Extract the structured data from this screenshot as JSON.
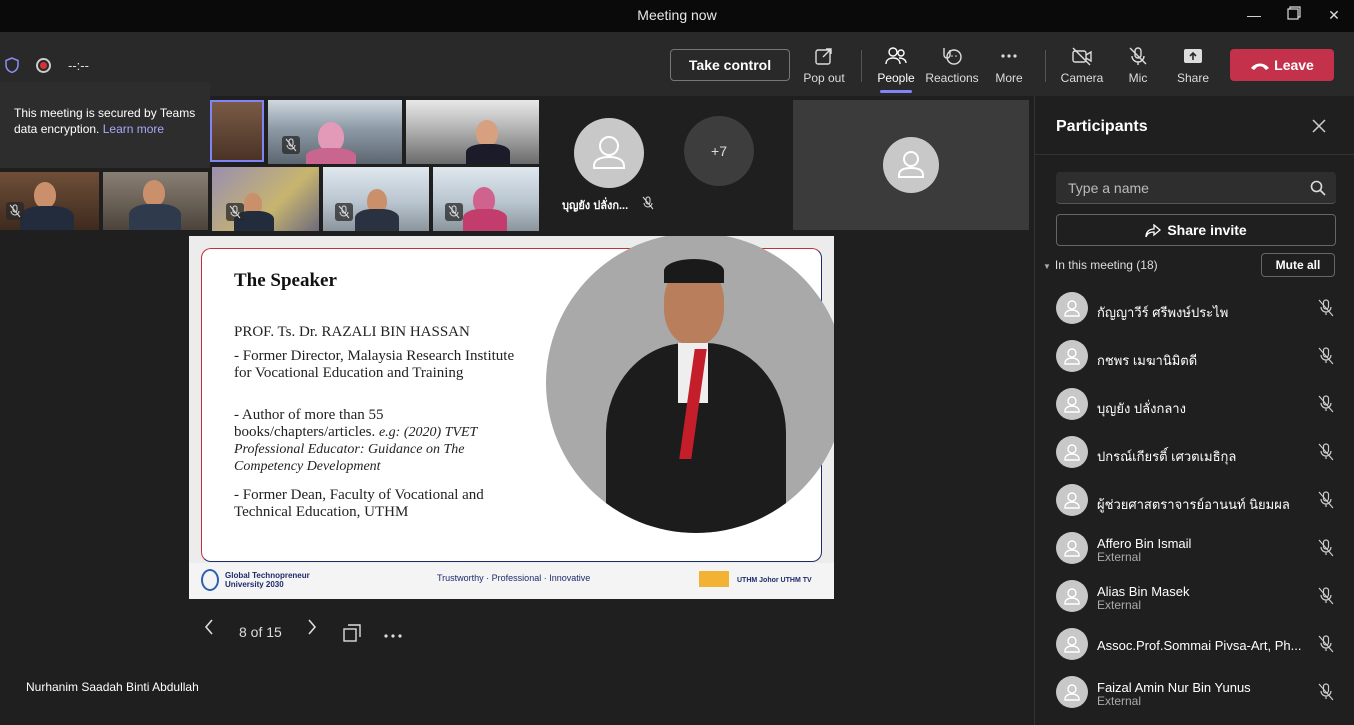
{
  "window": {
    "title": "Meeting now"
  },
  "toolbar": {
    "timer": "--:--",
    "take_control": "Take control",
    "pop_out": "Pop out",
    "people": "People",
    "reactions": "Reactions",
    "more": "More",
    "camera": "Camera",
    "mic": "Mic",
    "share": "Share",
    "leave": "Leave"
  },
  "tooltip": {
    "text": "This meeting is secured by Teams data encryption.",
    "link": "Learn more"
  },
  "gallery": {
    "overflow_count": "+7",
    "tile_name": "บุญยัง ปลั่งก..."
  },
  "slide": {
    "title": "The Speaker",
    "name": "PROF. Ts. Dr. RAZALI BIN HASSAN",
    "item1": "- Former Director, Malaysia Research Institute for Vocational Education and Training",
    "item2a": "- Author of more than 55 books/chapters/articles.",
    "item2b": "e.g: (2020) TVET Professional Educator: Guidance on The Competency Development",
    "item3": "- Former Dean, Faculty of Vocational and Technical Education, UTHM",
    "footer_left_1": "Global Technopreneur",
    "footer_left_2": "University 2030",
    "footer_mid": "Trustworthy · Professional · Innovative",
    "footer_right": "UTHM Johor  UTHM TV"
  },
  "slide_nav": {
    "page": "8 of 15"
  },
  "presenter_name": "Nurhanim Saadah Binti Abdullah",
  "panel": {
    "title": "Participants",
    "search_placeholder": "Type a name",
    "share_invite": "Share invite",
    "in_meeting": "In this meeting (18)",
    "mute_all": "Mute all",
    "participants": [
      {
        "name": "กัญญาวีร์ ศรีพงษ์ประไพ",
        "sub": ""
      },
      {
        "name": "กชพร เมฆานิมิตดี",
        "sub": ""
      },
      {
        "name": "บุญยัง ปลั่งกลาง",
        "sub": ""
      },
      {
        "name": "ปกรณ์เกียรติ์ เศวตเมธิกุล",
        "sub": ""
      },
      {
        "name": "ผู้ช่วยศาสตราจารย์อานนท์ นิยมผล",
        "sub": ""
      },
      {
        "name": "Affero Bin Ismail",
        "sub": "External"
      },
      {
        "name": "Alias Bin Masek",
        "sub": "External"
      },
      {
        "name": "Assoc.Prof.Sommai Pivsa-Art, Ph...",
        "sub": ""
      },
      {
        "name": "Faizal Amin Nur Bin Yunus",
        "sub": "External"
      }
    ]
  },
  "colors": {
    "accent": "#7f85f5",
    "leave": "#c4314b",
    "background": "#1f1f1f"
  }
}
